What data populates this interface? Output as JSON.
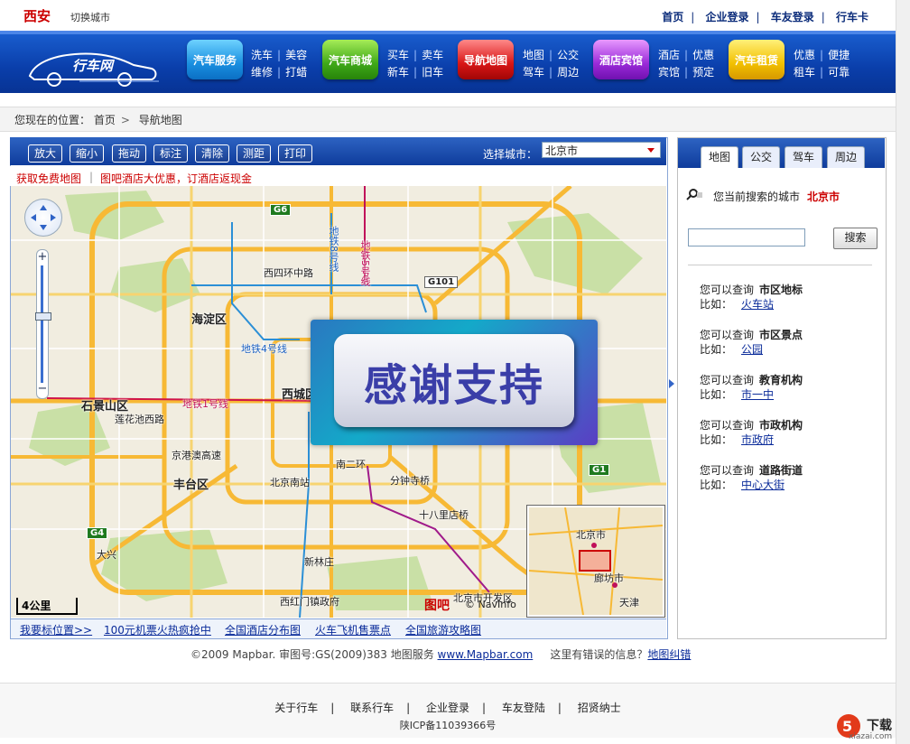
{
  "header": {
    "city": "西安",
    "switch_city": "切换城市",
    "links": [
      "首页",
      "企业登录",
      "车友登录",
      "行车卡"
    ]
  },
  "nav": {
    "logo_text": "行车网",
    "buttons": [
      "汽车服务",
      "汽车商城",
      "导航地图",
      "酒店宾馆",
      "汽车租赁"
    ],
    "sub": [
      [
        "洗车",
        "美容",
        "维修",
        "打蜡"
      ],
      [
        "买车",
        "卖车",
        "新车",
        "旧车"
      ],
      [
        "地图",
        "公交",
        "驾车",
        "周边"
      ],
      [
        "酒店",
        "优惠",
        "宾馆",
        "预定"
      ],
      [
        "优惠",
        "便捷",
        "租车",
        "可靠"
      ]
    ]
  },
  "breadcrumb": {
    "prefix": "您现在的位置：",
    "home": "首页",
    "current": "导航地图"
  },
  "map_toolbar": {
    "tools": [
      "放大",
      "缩小",
      "拖动",
      "标注",
      "清除",
      "测距",
      "打印"
    ],
    "city_label": "选择城市：",
    "city_value": "北京市"
  },
  "promo": {
    "left": "获取免费地图",
    "right": "图吧酒店大优惠，订酒店返现金"
  },
  "map": {
    "labels": {
      "haidian": "海淀区",
      "shijingshan": "石景山区",
      "xicheng": "西城区",
      "fengtai": "丰台区",
      "n2": "南二环",
      "fzsq": "分钟寺桥",
      "sbld": "十八里店桥",
      "metro4": "地铁4号线",
      "metro1": "地铁1号线",
      "metro5": "地铁5号线",
      "metro8": "地铁8号线",
      "g6": "G6",
      "g101": "G101",
      "g4": "G4",
      "g1": "G1",
      "beijing_south": "北京南站",
      "xisihuan": "西四环中路",
      "lianhuachi": "莲花池西路",
      "jinghang": "京港澳高速",
      "xinlinzhuang": "新林庄",
      "daxing": "大兴",
      "xhm": "西红门镇政府",
      "renjie": "北京市开发区"
    },
    "scale": "4公里",
    "brand": "图吧",
    "navinfo": "© NavInfo",
    "mini_labels": [
      "北京市",
      "廊坊市",
      "天津"
    ],
    "overlay_text": "感谢支持"
  },
  "map_bottom": [
    "我要标位置>>",
    "100元机票火热疯抢中",
    "全国酒店分布图",
    "火车飞机售票点",
    "全国旅游攻略图"
  ],
  "right_panel": {
    "tabs": [
      "地图",
      "公交",
      "驾车",
      "周边"
    ],
    "current_city_label": "您当前搜索的城市",
    "current_city": "北京市",
    "search_btn": "搜索",
    "queries": [
      {
        "label": "您可以查询",
        "kind": "市区地标",
        "ex_label": "比如：",
        "ex": "火车站"
      },
      {
        "label": "您可以查询",
        "kind": "市区景点",
        "ex_label": "比如：",
        "ex": "公园"
      },
      {
        "label": "您可以查询",
        "kind": "教育机构",
        "ex_label": "比如：",
        "ex": "市一中"
      },
      {
        "label": "您可以查询",
        "kind": "市政机构",
        "ex_label": "比如：",
        "ex": "市政府"
      },
      {
        "label": "您可以查询",
        "kind": "道路街道",
        "ex_label": "比如：",
        "ex": "中心大街"
      }
    ]
  },
  "copyright": {
    "text": "©2009 Mapbar. 审图号:GS(2009)383 地图服务",
    "site": "www.Mapbar.com",
    "error_q": "这里有错误的信息？",
    "error_link": "地图纠错"
  },
  "footer": {
    "links": [
      "关于行车",
      "联系行车",
      "企业登录",
      "车友登陆",
      "招贤纳士"
    ],
    "icp": "陕ICP备11039366号"
  },
  "watermark": {
    "brand": "下载",
    "sub": "xiazai.com"
  },
  "colors": {
    "nav_blue": "#0a3eaa",
    "accent_red": "#cc0000",
    "link_blue": "#0a2b9a"
  }
}
